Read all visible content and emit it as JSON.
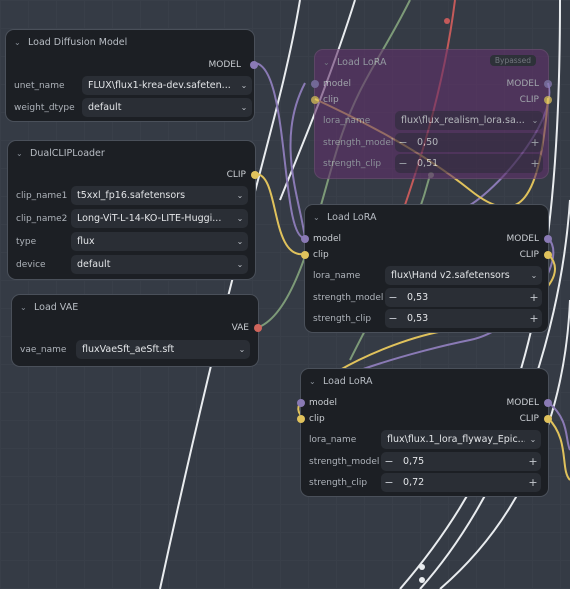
{
  "nodes": {
    "load_diffusion": {
      "title": "Load Diffusion Model",
      "output": "MODEL",
      "widgets": [
        {
          "label": "unet_name",
          "value": "FLUX\\flux1-krea-dev.safeten..."
        },
        {
          "label": "weight_dtype",
          "value": "default"
        }
      ]
    },
    "dual_clip": {
      "title": "DualCLIPLoader",
      "output": "CLIP",
      "widgets": [
        {
          "label": "clip_name1",
          "value": "t5xxl_fp16.safetensors"
        },
        {
          "label": "clip_name2",
          "value": "Long-ViT-L-14-KO-LITE-Huggi..."
        },
        {
          "label": "type",
          "value": "flux"
        },
        {
          "label": "device",
          "value": "default"
        }
      ]
    },
    "load_vae": {
      "title": "Load VAE",
      "output": "VAE",
      "widgets": [
        {
          "label": "vae_name",
          "value": "fluxVaeSft_aeSft.sft"
        }
      ]
    },
    "lora_bypassed": {
      "title": "Load LoRA",
      "badge": "Bypassed",
      "inputs": [
        "model",
        "clip"
      ],
      "outputs": [
        "MODEL",
        "CLIP"
      ],
      "lora_label": "lora_name",
      "lora_value": "flux\\flux_realism_lora.sa...",
      "sm_label": "strength_model",
      "sm_value": "0,50",
      "sc_label": "strength_clip",
      "sc_value": "0,51"
    },
    "lora_hand": {
      "title": "Load LoRA",
      "inputs": [
        "model",
        "clip"
      ],
      "outputs": [
        "MODEL",
        "CLIP"
      ],
      "lora_label": "lora_name",
      "lora_value": "flux\\Hand v2.safetensors",
      "sm_label": "strength_model",
      "sm_value": "0,53",
      "sc_label": "strength_clip",
      "sc_value": "0,53"
    },
    "lora_flyway": {
      "title": "Load LoRA",
      "inputs": [
        "model",
        "clip"
      ],
      "outputs": [
        "MODEL",
        "CLIP"
      ],
      "lora_label": "lora_name",
      "lora_value": "flux\\flux.1_lora_flyway_Epic...",
      "sm_label": "strength_model",
      "sm_value": "0,75",
      "sc_label": "strength_clip",
      "sc_value": "0,72"
    }
  },
  "colors": {
    "model": "#8a7ab5",
    "clip": "#e0c25c",
    "vae": "#d0655c",
    "bypassed": "#60306a"
  }
}
